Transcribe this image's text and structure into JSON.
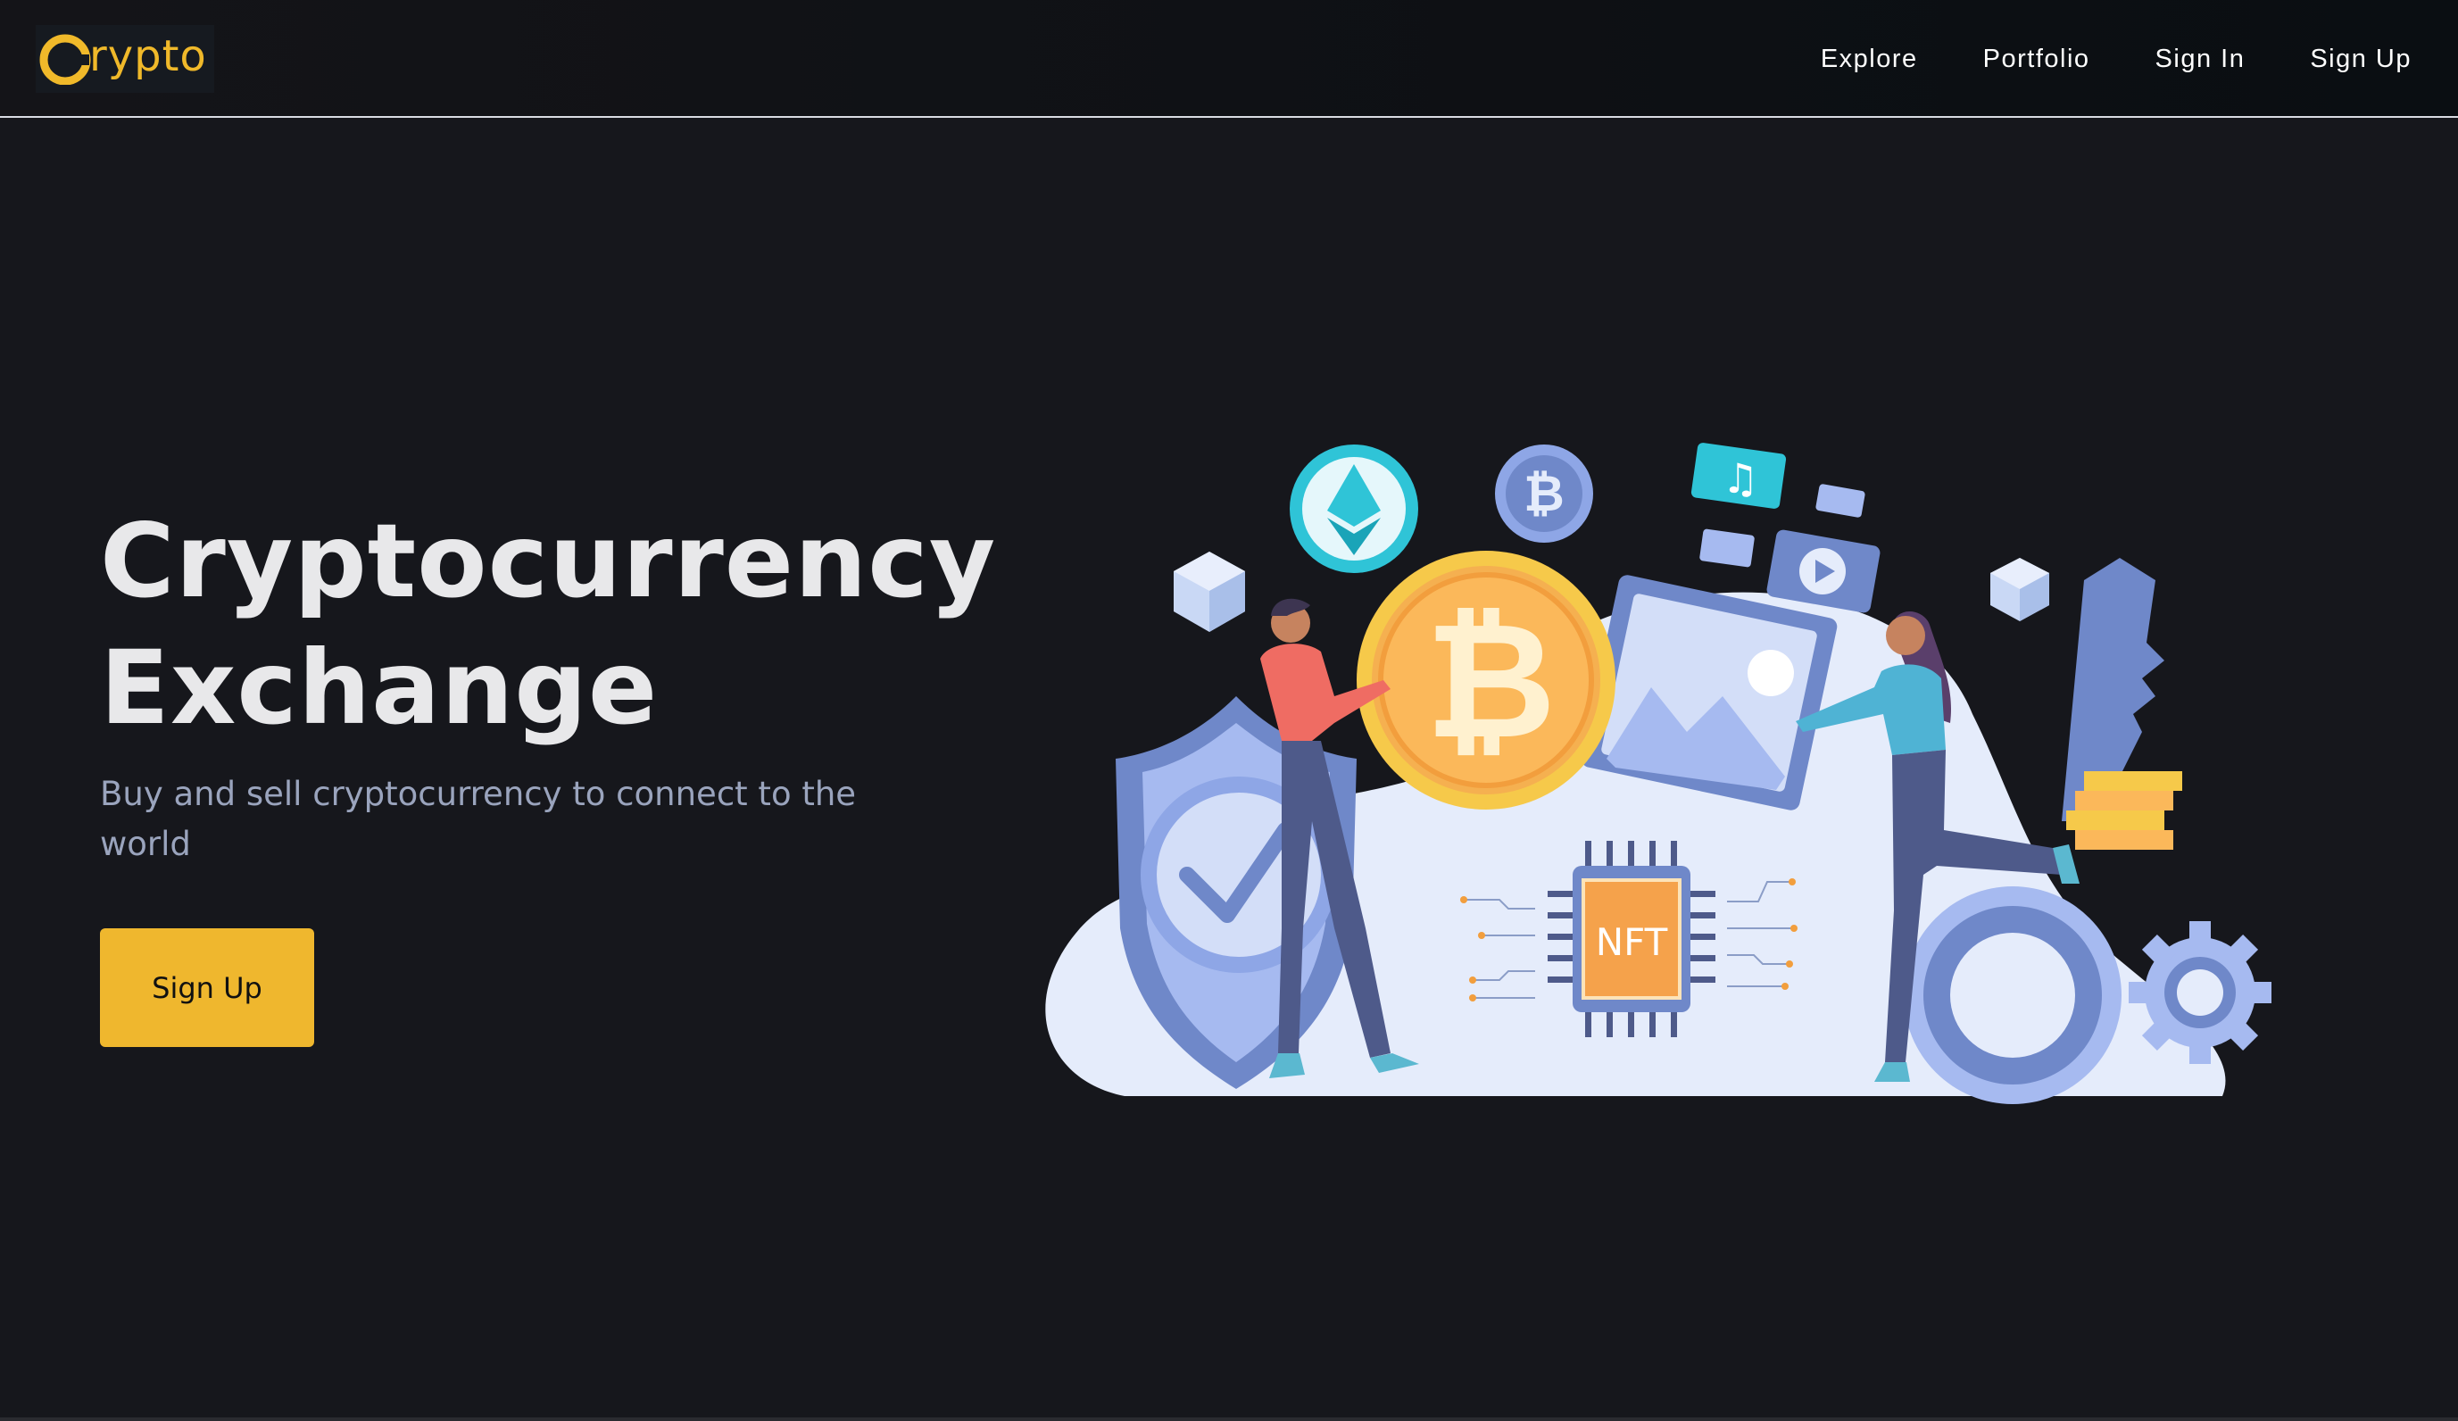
{
  "brand": {
    "logo_text": "rypto",
    "logo_icon": "crypto-coin-c-logo",
    "accent_color": "#f0b92a"
  },
  "nav": {
    "items": [
      {
        "label": "Explore"
      },
      {
        "label": "Portfolio"
      },
      {
        "label": "Sign In"
      },
      {
        "label": "Sign Up"
      }
    ]
  },
  "hero": {
    "title_line1": "Cryptocurrency",
    "title_line2": "Exchange",
    "subtitle": "Buy and sell cryptocurrency to connect to the world",
    "cta_label": "Sign Up",
    "cta_color": "#efb72e"
  },
  "illustration": {
    "nft_label": "NFT",
    "icons": [
      "ethereum-coin-icon",
      "bitcoin-coin-icon",
      "music-note-icon",
      "video-play-icon",
      "shield-check-icon",
      "image-frame-icon",
      "key-icon",
      "gear-icon",
      "cube-icon"
    ]
  }
}
